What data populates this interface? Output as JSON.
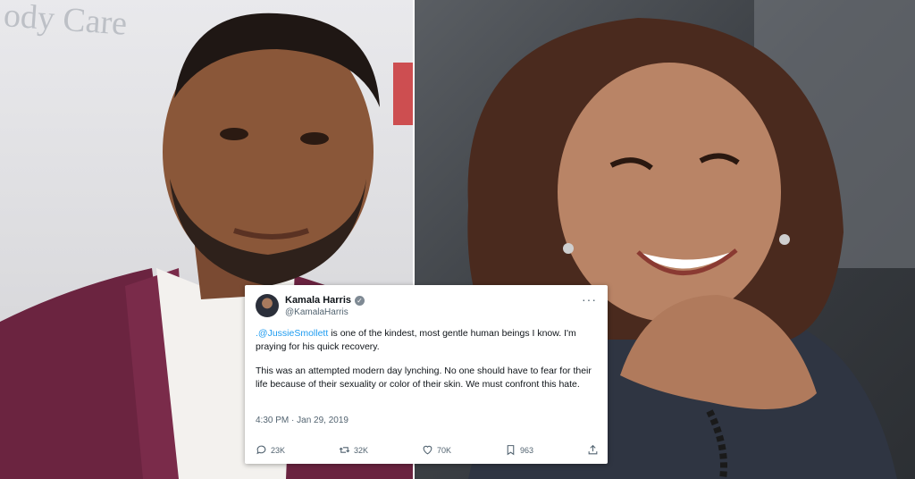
{
  "photos": {
    "left_sign_text": "ody Care"
  },
  "tweet": {
    "author_name": "Kamala Harris",
    "author_handle": "@KamalaHarris",
    "more_menu": "···",
    "mention": ".@JussieSmollett",
    "line1_rest": " is one of the kindest, most gentle human beings I know. I'm praying for his quick recovery.",
    "paragraph2": "This was an attempted modern day lynching. No one should have to fear for their life because of their sexuality or color of their skin. We must confront this hate.",
    "timestamp": "4:30 PM · Jan 29, 2019",
    "stats": {
      "replies": "23K",
      "retweets": "32K",
      "likes": "70K",
      "bookmarks": "963"
    }
  },
  "colors": {
    "link": "#1d9bf0",
    "secondary_text": "#536471"
  }
}
